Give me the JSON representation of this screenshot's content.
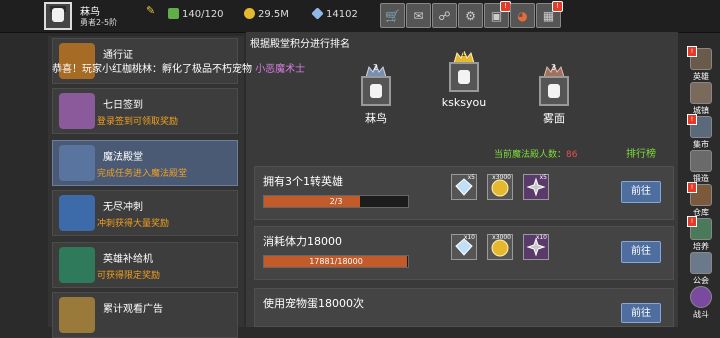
{
  "player": {
    "name": "菻鸟",
    "rank": "勇者2-5阶"
  },
  "resources": [
    {
      "icon": "stamina-icon",
      "value": "140/120"
    },
    {
      "icon": "coin-icon",
      "value": "29.5M"
    },
    {
      "icon": "gem-icon",
      "value": "14102"
    }
  ],
  "toolbar": [
    {
      "icon": "shop-cart-icon"
    },
    {
      "icon": "mail-icon"
    },
    {
      "icon": "chat-icon"
    },
    {
      "icon": "settings-gear-icon"
    },
    {
      "icon": "gift-box-icon"
    },
    {
      "icon": "color-wheel-icon"
    },
    {
      "icon": "calendar-icon"
    }
  ],
  "marquee": {
    "text": "恭喜！玩家小红枷桃林：孵化了极品不朽宠物",
    "pet": "小恶魔术士"
  },
  "left_menu": [
    {
      "title": "通行证",
      "subtitle": "",
      "icon": "trophy-icon"
    },
    {
      "title": "七日签到",
      "subtitle": "登录签到可领取奖励",
      "icon": "treasure-chest-icon"
    },
    {
      "title": "魔法殿堂",
      "subtitle": "完成任务进入魔法殿堂",
      "icon": "crown-hall-icon"
    },
    {
      "title": "无尽冲刺",
      "subtitle": "冲刺获得大量奖励",
      "icon": "sprint-shield-icon"
    },
    {
      "title": "英雄补给机",
      "subtitle": "可获得限定奖励",
      "icon": "supply-machine-icon"
    },
    {
      "title": "累计观看广告",
      "subtitle": "",
      "icon": "ad-reward-icon"
    }
  ],
  "ranking": {
    "title": "根据殿堂积分进行排名",
    "podium": [
      {
        "rank": "1",
        "name": "ksksyou"
      },
      {
        "rank": "2",
        "name": "菻鸟"
      },
      {
        "rank": "3",
        "name": "雾面"
      }
    ],
    "count_label": "当前魔法殿人数：",
    "count_value": "86",
    "rank_button": "排行榜"
  },
  "tasks": [
    {
      "title": "拥有3个1转英雄",
      "progress_text": "2/3",
      "progress": 0.667,
      "rewards": [
        {
          "icon": "diamond-icon",
          "count": "x5"
        },
        {
          "icon": "gold-coin-icon",
          "count": "x3000"
        },
        {
          "icon": "shuriken-icon",
          "count": "x5"
        }
      ],
      "button": "前往"
    },
    {
      "title": "消耗体力18000",
      "progress_text": "17881/18000",
      "progress": 0.993,
      "rewards": [
        {
          "icon": "diamond-icon",
          "count": "x10"
        },
        {
          "icon": "gold-coin-icon",
          "count": "x3000"
        },
        {
          "icon": "shuriken-icon",
          "count": "x10"
        }
      ],
      "button": "前往"
    },
    {
      "title": "使用宠物蛋18000次",
      "progress_text": "",
      "progress": 0,
      "rewards": [],
      "button": "前往"
    }
  ],
  "sidebar": [
    {
      "label": "英雄",
      "icon": "hero-icon"
    },
    {
      "label": "城镇",
      "icon": "town-icon"
    },
    {
      "label": "集市",
      "icon": "market-icon"
    },
    {
      "label": "锻造",
      "icon": "forge-icon"
    },
    {
      "label": "仓库",
      "icon": "warehouse-icon"
    },
    {
      "label": "培养",
      "icon": "train-icon"
    },
    {
      "label": "公会",
      "icon": "guild-icon"
    },
    {
      "label": "战斗",
      "icon": "battle-icon"
    }
  ],
  "colors": {
    "accent_green": "#7fdc3a",
    "accent_orange": "#f0a020",
    "progress_fill": "#c25a2a",
    "button_blue": "#4e6ea0"
  }
}
